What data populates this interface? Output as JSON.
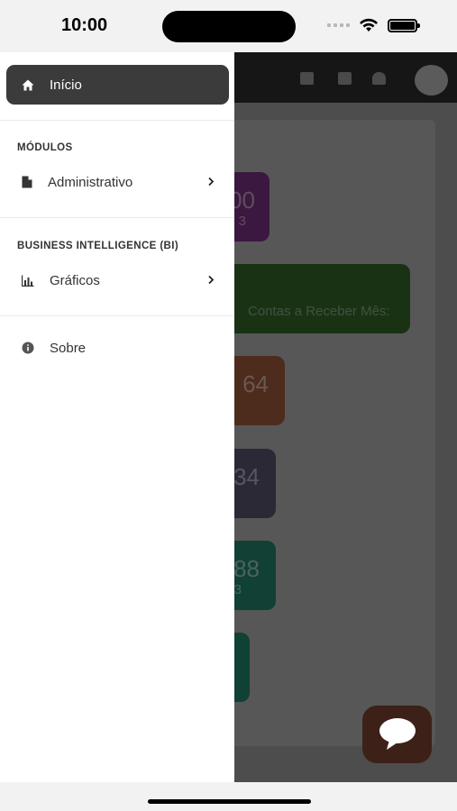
{
  "status_bar": {
    "time": "10:00"
  },
  "drawer": {
    "home": {
      "label": "Início",
      "icon": "home-icon"
    },
    "sections": [
      {
        "title": "MÓDULOS",
        "items": [
          {
            "label": "Administrativo",
            "icon": "document-icon"
          }
        ]
      },
      {
        "title": "BUSINESS INTELLIGENCE (BI)",
        "items": [
          {
            "label": "Gráficos",
            "icon": "bar-chart-icon"
          }
        ]
      }
    ],
    "about": {
      "label": "Sobre",
      "icon": "info-icon"
    }
  },
  "background_app": {
    "cards": [
      {
        "value": "00",
        "sub": "3",
        "color": "#6b2c72"
      },
      {
        "label": "Contas a Receber Mês:",
        "color": "#2d5a25"
      },
      {
        "value": "64",
        "color": "#8c5034"
      },
      {
        "value": "34",
        "color": "#4f4a62"
      },
      {
        "value": "88",
        "sub": "3",
        "color": "#1f7561"
      },
      {
        "color": "#1f7561"
      }
    ]
  },
  "colors": {
    "drawer_active": "#3b3b3b",
    "chat_button": "#3d2119",
    "overlay": "#4d4d4d"
  }
}
